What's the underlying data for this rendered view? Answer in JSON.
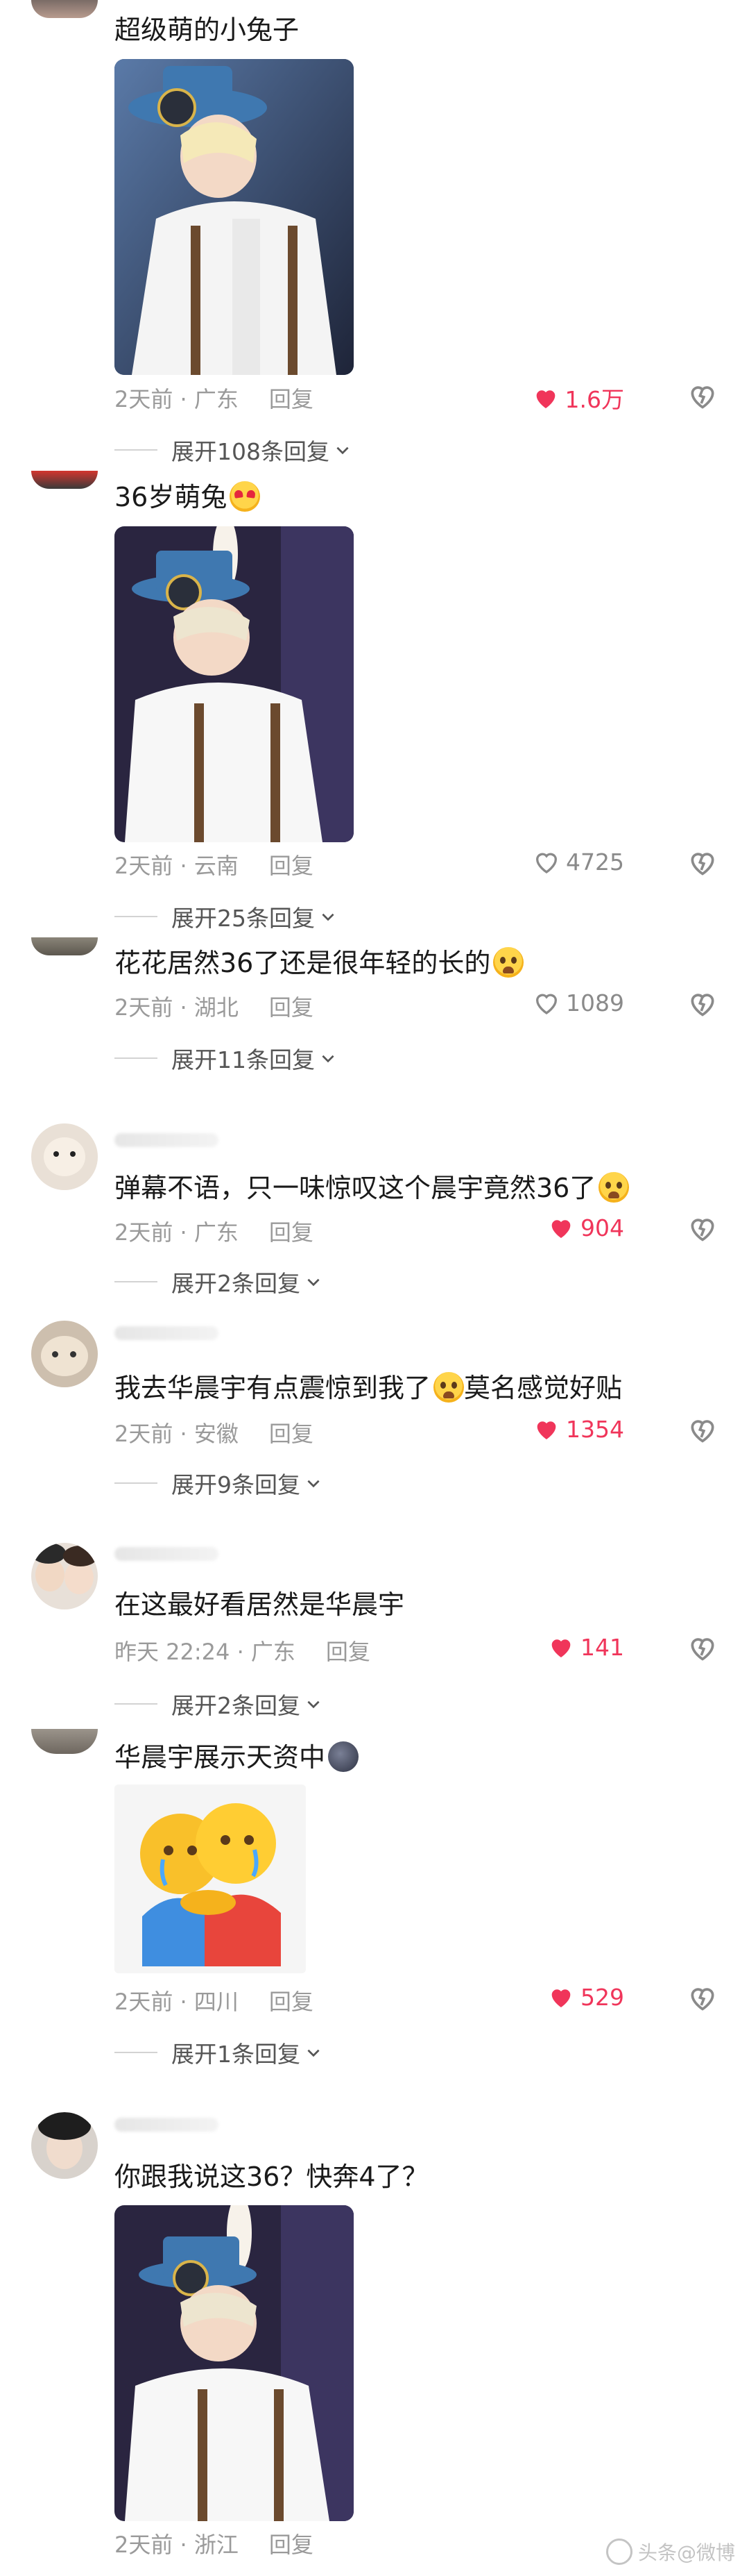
{
  "comments": [
    {
      "text": "超级萌的小兔子",
      "meta": "2天前 · 广东",
      "reply_label": "回复",
      "likes": "1.6万",
      "liked": true,
      "has_image": true,
      "expand_label": "展开108条回复"
    },
    {
      "text": "36岁萌兔",
      "emoji": "heart-eyes-emoji",
      "meta": "2天前 · 云南",
      "reply_label": "回复",
      "likes": "4725",
      "liked": false,
      "has_image": true,
      "expand_label": "展开25条回复"
    },
    {
      "text": "花花居然36了还是很年轻的长的",
      "emoji": "crying-emoji",
      "meta": "2天前 · 湖北",
      "reply_label": "回复",
      "likes": "1089",
      "liked": false,
      "expand_label": "展开11条回复"
    },
    {
      "text": "弹幕不语，只一味惊叹这个晨宇竟然36了",
      "emoji": "crying-emoji",
      "meta": "2天前 · 广东",
      "reply_label": "回复",
      "likes": "904",
      "liked": true,
      "expand_label": "展开2条回复"
    },
    {
      "text": "我去华晨宇有点震惊到我了",
      "emoji": "astonished-emoji",
      "text_after": "莫名感觉好贴",
      "meta": "2天前 · 安徽",
      "reply_label": "回复",
      "likes": "1354",
      "liked": true,
      "expand_label": "展开9条回复"
    },
    {
      "text": "在这最好看居然是华晨宇",
      "meta": "昨天 22:24 · 广东",
      "reply_label": "回复",
      "likes": "141",
      "liked": true,
      "expand_label": "展开2条回复"
    },
    {
      "text": "华晨宇展示天资中",
      "emoji": "dark-face-emoji",
      "meta": "2天前 · 四川",
      "reply_label": "回复",
      "likes": "529",
      "liked": true,
      "has_sticker": true,
      "expand_label": "展开1条回复"
    },
    {
      "text": "你跟我说这36？快奔4了？",
      "meta": "2天前 · 浙江",
      "reply_label": "回复",
      "has_image": true
    }
  ],
  "watermark": "头条@微博",
  "colors": {
    "like_active": "#f0355a",
    "meta_gray": "#9a9a9a",
    "text": "#1a1a1a"
  }
}
